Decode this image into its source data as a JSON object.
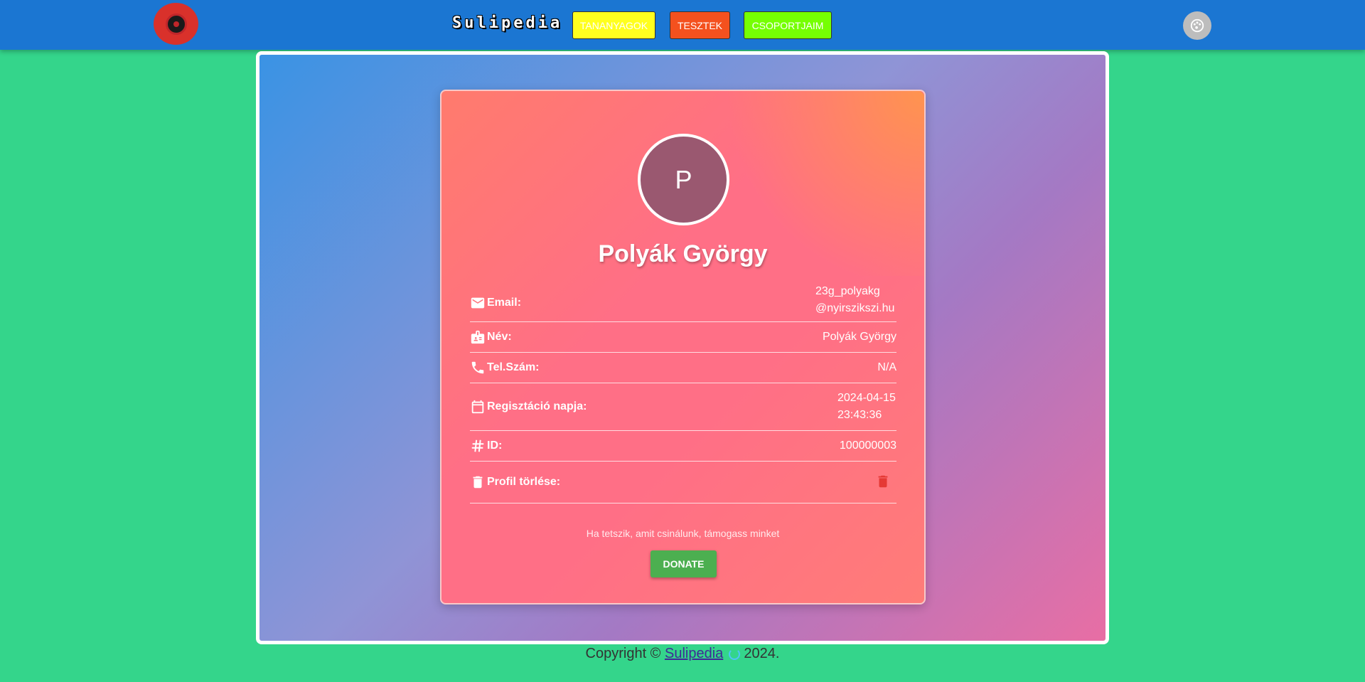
{
  "header": {
    "brand": "Sulipedia",
    "nav": [
      {
        "label": "TANANYAGOK",
        "color": "#ffff1f"
      },
      {
        "label": "TESZTEK",
        "color": "#f4511e"
      },
      {
        "label": "CSOPORTJAIM",
        "color": "#76ff03"
      }
    ]
  },
  "profile": {
    "initial": "P",
    "name": "Polyák György",
    "fields": {
      "email": {
        "label": "Email:",
        "value_line1": "23g_polyakg",
        "value_line2": "@nyirszikszi.hu",
        "icon": "mail-icon"
      },
      "nev": {
        "label": "Név:",
        "value": "Polyák György",
        "icon": "badge-icon"
      },
      "tel": {
        "label": "Tel.Szám:",
        "value": "N/A",
        "icon": "phone-icon"
      },
      "reg": {
        "label": "Regisztáció napja:",
        "value_line1": "2024-04-15",
        "value_line2": "23:43:36",
        "icon": "calendar-icon"
      },
      "id": {
        "label": "ID:",
        "value": "100000003",
        "icon": "hash-icon"
      },
      "delete": {
        "label": "Profil törlése:",
        "icon": "trash-icon"
      }
    },
    "support_text": "Ha tetszik, amit csinálunk, támogass minket",
    "donate_label": "DONATE"
  },
  "footer": {
    "prefix": "Copyright ©",
    "link": "Sulipedia",
    "suffix": "2024."
  },
  "colors": {
    "header": "#1b76d2",
    "background": "#34d58b",
    "donate": "#4caf50",
    "delete": "#e53935"
  }
}
